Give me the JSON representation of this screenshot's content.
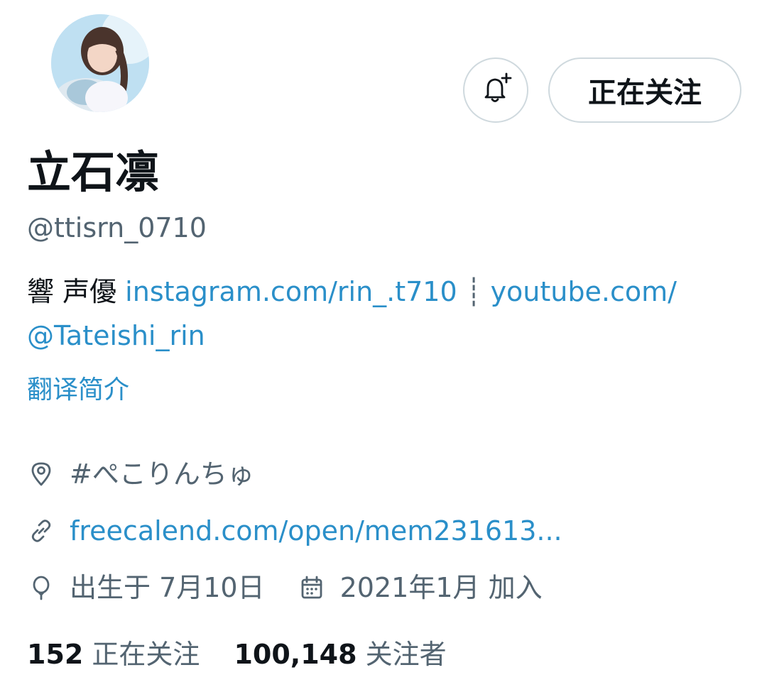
{
  "profile": {
    "name": "立石凛",
    "handle": "@ttisrn_0710",
    "follow_label": "正在关注",
    "bio_prefix": "響 声優 ",
    "bio_link_1": "instagram.com/rin_.t710",
    "bio_separator": "┊",
    "bio_link_2_part1": "youtube.com/",
    "bio_link_2_part2": "@Tateishi_rin",
    "translate_label": "翻译简介",
    "location": "#ぺこりんちゅ",
    "website": "freecalend.com/open/mem231613...",
    "birthday": "出生于 7月10日",
    "joined": "2021年1月 加入",
    "following_count": "152",
    "following_label": "正在关注",
    "followers_count": "100,148",
    "followers_label": "关注者"
  },
  "icons": {
    "bell": "bell-plus-icon",
    "location": "location-pin-icon",
    "link": "link-icon",
    "birthday": "balloon-icon",
    "calendar": "calendar-icon"
  },
  "colors": {
    "text": "#0f1419",
    "secondary": "#536471",
    "link": "#2a8fc9",
    "border": "#cfd9de"
  }
}
